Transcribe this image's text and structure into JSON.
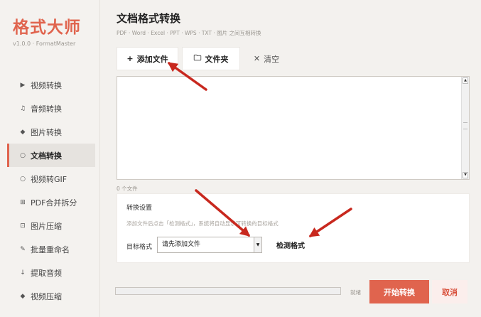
{
  "sidebar": {
    "brand": "格式大师",
    "version": "v1.0.0 · FormatMaster",
    "items": [
      {
        "icon": "▶",
        "label": "视频转换"
      },
      {
        "icon": "♫",
        "label": "音频转换"
      },
      {
        "icon": "◆",
        "label": "图片转换"
      },
      {
        "icon": "○",
        "label": "文档转换"
      },
      {
        "icon": "○",
        "label": "视频转GIF"
      },
      {
        "icon": "⊞",
        "label": "PDF合并拆分"
      },
      {
        "icon": "⊡",
        "label": "图片压缩"
      },
      {
        "icon": "✎",
        "label": "批量重命名"
      },
      {
        "icon": "↓",
        "label": "提取音频"
      },
      {
        "icon": "◆",
        "label": "视频压缩"
      }
    ]
  },
  "main": {
    "title": "文档格式转换",
    "subtitle": "PDF · Word · Excel · PPT · WPS · TXT · 图片 之间互相转换",
    "toolbar": {
      "add_icon": "+",
      "add_label": "添加文件",
      "folder_icon": "🗀",
      "folder_label": "文件夹",
      "clear_icon": "✕",
      "clear_label": "清空"
    },
    "file_count": "0 个文件",
    "settings": {
      "title": "转换设置",
      "hint": "添加文件后点击「检测格式」，系统将自动显示可转换的目标格式",
      "target_label": "目标格式",
      "target_value": "请先添加文件",
      "detect_label": "检测格式"
    },
    "progress": 0,
    "status": "就绪",
    "start_label": "开始转换",
    "cancel_label": "取消"
  },
  "colors": {
    "accent": "#e0644e",
    "annotation_arrow": "#c8281e"
  }
}
